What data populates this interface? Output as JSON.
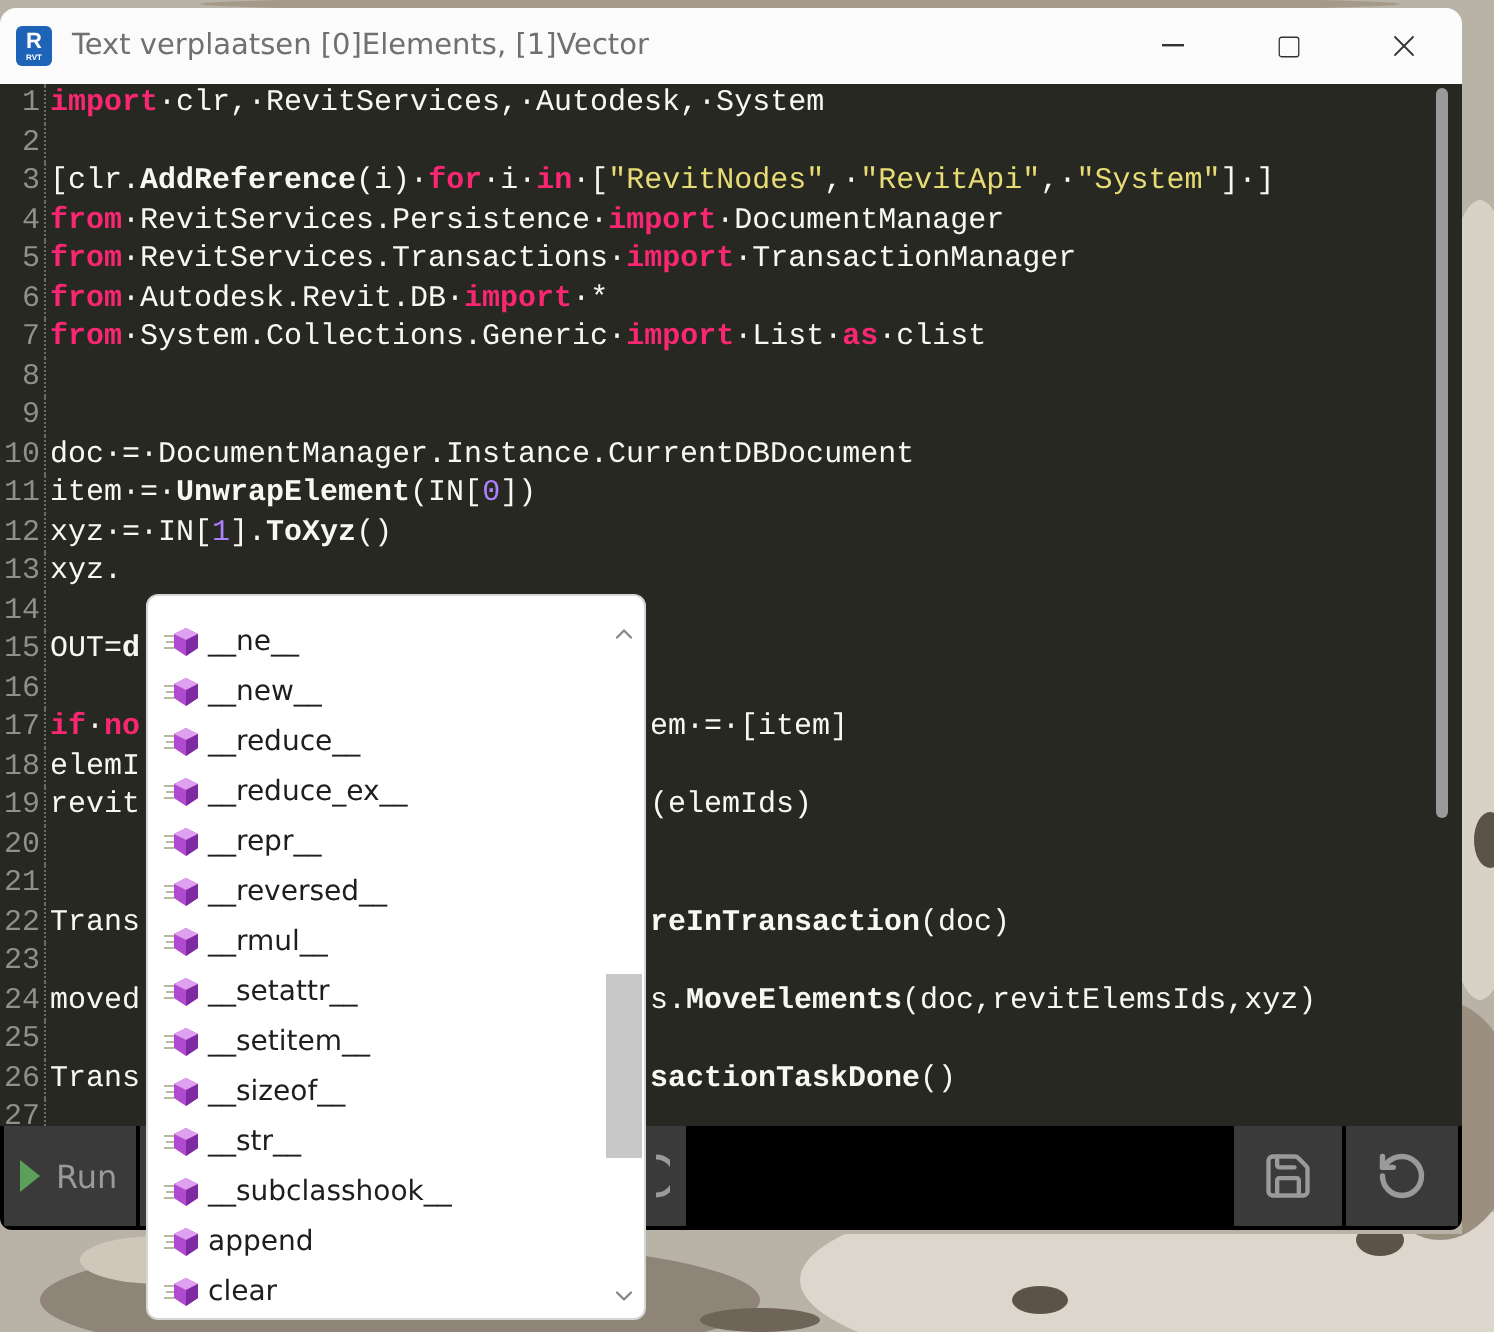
{
  "window": {
    "title": "Text verplaatsen [0]Elements, [1]Vector",
    "app_icon": {
      "letter": "R",
      "caption": "RVT"
    }
  },
  "editor": {
    "lines": [
      {
        "number": "1",
        "tokens": [
          {
            "kind": "keyword",
            "text": "import"
          },
          {
            "kind": "text",
            "text": "·clr,·RevitServices,·Autodesk,·System"
          }
        ]
      },
      {
        "number": "2"
      },
      {
        "number": "3",
        "tokens": [
          {
            "kind": "text",
            "text": "[clr."
          },
          {
            "kind": "call",
            "text": "AddReference"
          },
          {
            "kind": "text",
            "text": "(i)·"
          },
          {
            "kind": "keyword",
            "text": "for"
          },
          {
            "kind": "text",
            "text": "·i·"
          },
          {
            "kind": "keyword",
            "text": "in"
          },
          {
            "kind": "text",
            "text": "·["
          },
          {
            "kind": "string",
            "text": "\"RevitNodes\""
          },
          {
            "kind": "text",
            "text": ",·"
          },
          {
            "kind": "string",
            "text": "\"RevitApi\""
          },
          {
            "kind": "text",
            "text": ",·"
          },
          {
            "kind": "string",
            "text": "\"System\""
          },
          {
            "kind": "text",
            "text": "]·]"
          }
        ]
      },
      {
        "number": "4",
        "tokens": [
          {
            "kind": "keyword",
            "text": "from"
          },
          {
            "kind": "text",
            "text": "·RevitServices.Persistence·"
          },
          {
            "kind": "keyword",
            "text": "import"
          },
          {
            "kind": "text",
            "text": "·DocumentManager"
          }
        ]
      },
      {
        "number": "5",
        "tokens": [
          {
            "kind": "keyword",
            "text": "from"
          },
          {
            "kind": "text",
            "text": "·RevitServices.Transactions·"
          },
          {
            "kind": "keyword",
            "text": "import"
          },
          {
            "kind": "text",
            "text": "·TransactionManager"
          }
        ]
      },
      {
        "number": "6",
        "tokens": [
          {
            "kind": "keyword",
            "text": "from"
          },
          {
            "kind": "text",
            "text": "·Autodesk.Revit.DB·"
          },
          {
            "kind": "keyword",
            "text": "import"
          },
          {
            "kind": "text",
            "text": "·*"
          }
        ]
      },
      {
        "number": "7",
        "tokens": [
          {
            "kind": "keyword",
            "text": "from"
          },
          {
            "kind": "text",
            "text": "·System.Collections.Generic·"
          },
          {
            "kind": "keyword",
            "text": "import"
          },
          {
            "kind": "text",
            "text": "·List·"
          },
          {
            "kind": "keyword",
            "text": "as"
          },
          {
            "kind": "text",
            "text": "·clist"
          }
        ]
      },
      {
        "number": "8"
      },
      {
        "number": "9"
      },
      {
        "number": "10",
        "tokens": [
          {
            "kind": "text",
            "text": "doc·=·DocumentManager.Instance.CurrentDBDocument"
          }
        ]
      },
      {
        "number": "11",
        "tokens": [
          {
            "kind": "text",
            "text": "item·=·"
          },
          {
            "kind": "call",
            "text": "UnwrapElement"
          },
          {
            "kind": "text",
            "text": "(IN["
          },
          {
            "kind": "number",
            "text": "0"
          },
          {
            "kind": "text",
            "text": "])"
          }
        ]
      },
      {
        "number": "12",
        "tokens": [
          {
            "kind": "text",
            "text": "xyz·=·IN["
          },
          {
            "kind": "number",
            "text": "1"
          },
          {
            "kind": "text",
            "text": "]."
          },
          {
            "kind": "call",
            "text": "ToXyz"
          },
          {
            "kind": "text",
            "text": "()"
          }
        ]
      },
      {
        "number": "13",
        "tokens": [
          {
            "kind": "text",
            "text": "xyz."
          }
        ]
      },
      {
        "number": "14"
      },
      {
        "number": "15",
        "tokens": [
          {
            "kind": "text",
            "text": "OUT="
          },
          {
            "kind": "call",
            "text": "d"
          }
        ]
      },
      {
        "number": "16"
      },
      {
        "number": "17",
        "tokens": [
          {
            "kind": "keyword",
            "text": "if"
          },
          {
            "kind": "text",
            "text": "·"
          },
          {
            "kind": "keyword",
            "text": "no"
          }
        ],
        "tail": [
          {
            "kind": "text",
            "text": "em·=·[item]"
          }
        ]
      },
      {
        "number": "18",
        "tokens": [
          {
            "kind": "text",
            "text": "elemI"
          }
        ]
      },
      {
        "number": "19",
        "tokens": [
          {
            "kind": "text",
            "text": "revit"
          }
        ],
        "tail": [
          {
            "kind": "text",
            "text": "(elemIds)"
          }
        ]
      },
      {
        "number": "20"
      },
      {
        "number": "21"
      },
      {
        "number": "22",
        "tokens": [
          {
            "kind": "text",
            "text": "Trans"
          }
        ],
        "tail": [
          {
            "kind": "call",
            "text": "reInTransaction"
          },
          {
            "kind": "text",
            "text": "(doc)"
          }
        ]
      },
      {
        "number": "23"
      },
      {
        "number": "24",
        "tokens": [
          {
            "kind": "text",
            "text": "moved"
          }
        ],
        "tail": [
          {
            "kind": "text",
            "text": "s."
          },
          {
            "kind": "call",
            "text": "MoveElements"
          },
          {
            "kind": "text",
            "text": "(doc,revitElemsIds,xyz)"
          }
        ]
      },
      {
        "number": "25"
      },
      {
        "number": "26",
        "tokens": [
          {
            "kind": "text",
            "text": "Trans"
          }
        ],
        "tail": [
          {
            "kind": "call",
            "text": "sactionTaskDone"
          },
          {
            "kind": "text",
            "text": "()"
          }
        ]
      },
      {
        "number": "27"
      }
    ]
  },
  "autocomplete": {
    "items": [
      {
        "label": "__ne__"
      },
      {
        "label": "__new__"
      },
      {
        "label": "__reduce__"
      },
      {
        "label": "__reduce_ex__"
      },
      {
        "label": "__repr__"
      },
      {
        "label": "__reversed__"
      },
      {
        "label": "__rmul__"
      },
      {
        "label": "__setattr__"
      },
      {
        "label": "__setitem__"
      },
      {
        "label": "__sizeof__"
      },
      {
        "label": "__str__"
      },
      {
        "label": "__subclasshook__"
      },
      {
        "label": "append"
      },
      {
        "label": "clear"
      }
    ]
  },
  "toolbar": {
    "run_label": "Run"
  }
}
